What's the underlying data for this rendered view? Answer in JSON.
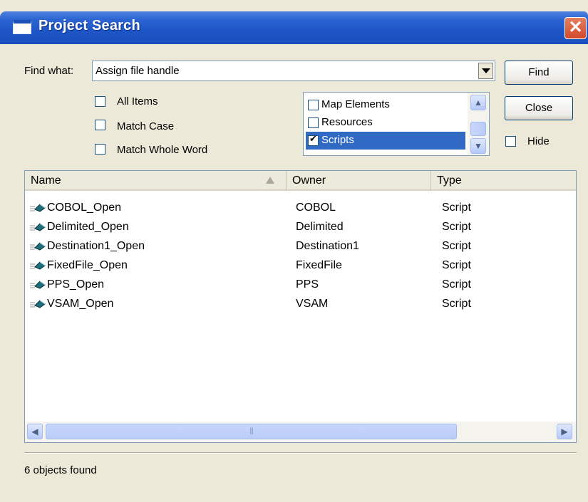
{
  "window": {
    "title": "Project Search"
  },
  "find": {
    "label": "Find what:",
    "value": "Assign file handle"
  },
  "options": {
    "all_items": "All Items",
    "match_case": "Match Case",
    "match_whole_word": "Match Whole Word"
  },
  "types": [
    {
      "label": "Map Elements",
      "checked": false,
      "selected": false
    },
    {
      "label": "Resources",
      "checked": false,
      "selected": false
    },
    {
      "label": "Scripts",
      "checked": true,
      "selected": true
    }
  ],
  "buttons": {
    "find": "Find",
    "close": "Close",
    "hide": "Hide"
  },
  "table": {
    "columns": [
      "Name",
      "Owner",
      "Type"
    ],
    "rows": [
      {
        "name": "COBOL_Open",
        "owner": "COBOL",
        "type": "Script"
      },
      {
        "name": "Delimited_Open",
        "owner": "Delimited",
        "type": "Script"
      },
      {
        "name": "Destination1_Open",
        "owner": "Destination1",
        "type": "Script"
      },
      {
        "name": "FixedFile_Open",
        "owner": "FixedFile",
        "type": "Script"
      },
      {
        "name": "PPS_Open",
        "owner": "PPS",
        "type": "Script"
      },
      {
        "name": "VSAM_Open",
        "owner": "VSAM",
        "type": "Script"
      }
    ]
  },
  "status": "6 objects found",
  "colors": {
    "titlebar": "#1E55C6",
    "selection": "#316AC5",
    "close_button": "#D2492B",
    "dialog_bg": "#ECE9D8"
  }
}
